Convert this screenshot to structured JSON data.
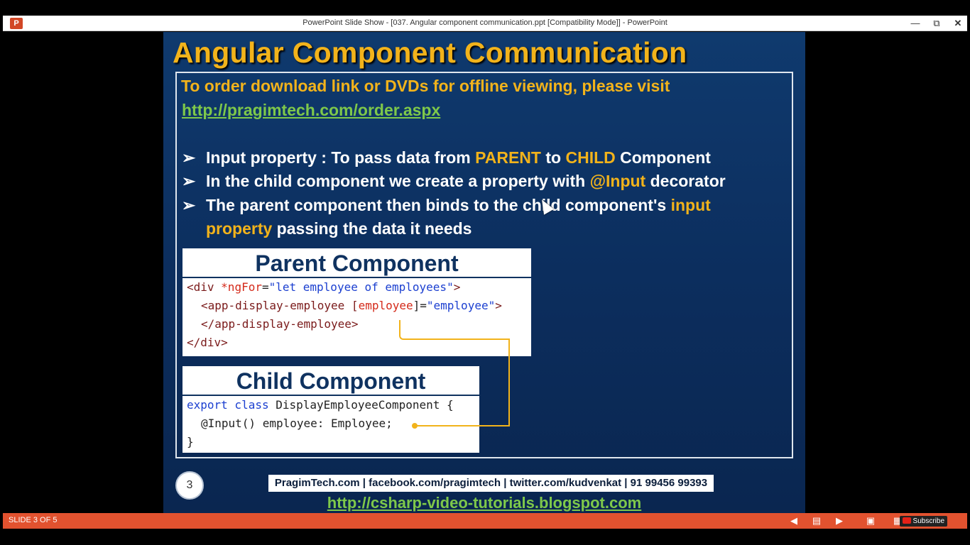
{
  "window": {
    "app_icon": "P",
    "title": "PowerPoint Slide Show - [037. Angular component communication.ppt [Compatibility Mode]] - PowerPoint",
    "controls": [
      "minimize-icon",
      "restore-icon",
      "close-icon"
    ]
  },
  "slide": {
    "title": "Angular Component Communication",
    "order_text": "To order download link or DVDs for offline viewing, please visit",
    "order_link": "http://pragimtech.com/order.aspx",
    "bullets": [
      {
        "parts": [
          "Input property : To pass data from ",
          "PARENT",
          " to ",
          "CHILD",
          " Component"
        ]
      },
      {
        "parts": [
          "In the child component we create a property with ",
          "@Input",
          " decorator"
        ]
      },
      {
        "parts": [
          "The parent component then binds to the child component's ",
          "input"
        ]
      },
      {
        "parts": [
          "property",
          " passing the data it needs"
        ]
      }
    ],
    "parent_component": {
      "header": "Parent Component",
      "line1": [
        "<div ",
        "*ngFor",
        "=",
        "\"let employee of employees\"",
        ">"
      ],
      "line2": [
        "<app-display-employee [",
        "employee",
        "]=",
        "\"employee\"",
        ">"
      ],
      "line3": "</app-display-employee>",
      "line4": "</div>"
    },
    "child_component": {
      "header": "Child Component",
      "line1": [
        "export class",
        " DisplayEmployeeComponent {"
      ],
      "line2": "@Input() employee: Employee;",
      "line3": "}"
    },
    "slide_number": "3",
    "footer_contacts": "PragimTech.com | facebook.com/pragimtech | twitter.com/kudvenkat | 91 99456 99393",
    "footer_link": "http://csharp-video-tutorials.blogspot.com"
  },
  "statusbar": {
    "slide_counter": "SLIDE 3 OF 5",
    "subscribe": "Subscribe",
    "icons": [
      "previous-icon",
      "notes-icon",
      "next-icon",
      "reading-view-icon",
      "slide-sorter-icon"
    ]
  },
  "colors": {
    "accent_yellow": "#f2b31b",
    "link_green": "#7ec84a",
    "slide_blue": "#0f3a6e",
    "status_orange": "#e2522f"
  }
}
